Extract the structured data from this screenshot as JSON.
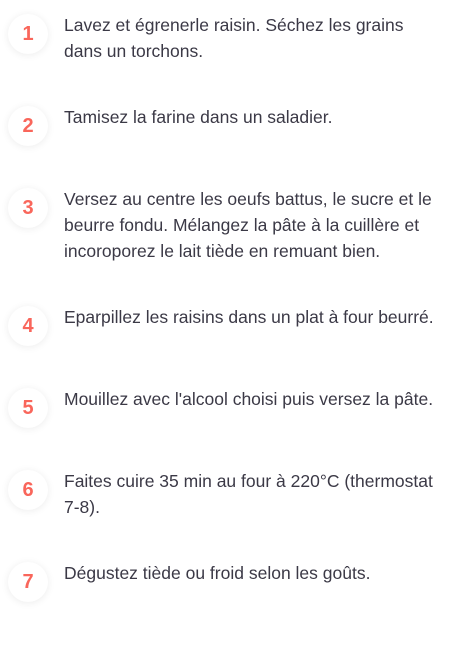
{
  "accent_color": "#f9665b",
  "steps": [
    {
      "number": "1",
      "text": "Lavez et égrenerle raisin. Séchez les grains dans un torchons."
    },
    {
      "number": "2",
      "text": "Tamisez la farine dans un saladier."
    },
    {
      "number": "3",
      "text": "Versez au centre les oeufs battus, le sucre et le beurre fondu. Mélangez la pâte à la cuillère et incoroporez le lait tiède en remuant bien."
    },
    {
      "number": "4",
      "text": "Eparpillez les raisins dans un plat à four beurré."
    },
    {
      "number": "5",
      "text": "Mouillez avec l'alcool choisi puis versez la pâte."
    },
    {
      "number": "6",
      "text": "Faites cuire 35 min au four à 220°C (thermostat 7-8)."
    },
    {
      "number": "7",
      "text": "Dégustez tiède ou froid selon les goûts."
    }
  ]
}
